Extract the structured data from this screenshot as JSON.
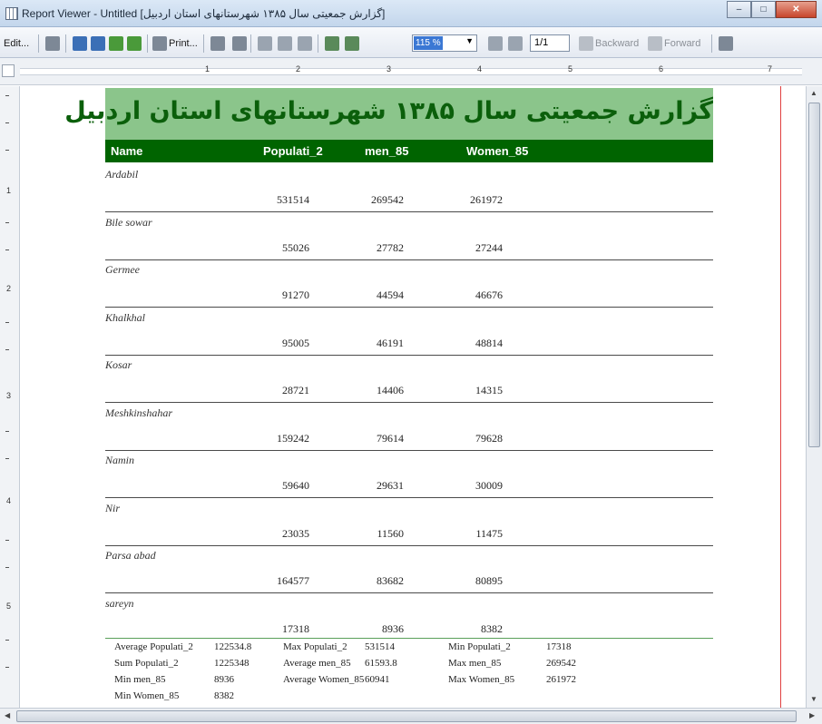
{
  "window": {
    "title": "Report Viewer - Untitled [گزارش جمعیتی سال ۱۳۸۵ شهرستانهای استان اردبیل]",
    "minimize_icon": "minimize-icon",
    "maximize_icon": "maximize-icon",
    "close_icon": "close-icon"
  },
  "toolbar": {
    "edit_label": "Edit...",
    "print_label": "Print...",
    "zoom_value": "115 %",
    "page_value": "1/1",
    "backward_label": "Backward",
    "forward_label": "Forward",
    "colors": {
      "icon_blue": "#3b6fb6",
      "icon_green": "#4a9a3a",
      "icon_gray": "#7d8896"
    }
  },
  "ruler": {
    "h_numbers": [
      "1",
      "2",
      "3",
      "4",
      "5",
      "6",
      "7"
    ],
    "v_numbers": [
      "1",
      "2",
      "3",
      "4",
      "5"
    ]
  },
  "report": {
    "title": "گزارش جمعیتی سال ۱۳۸۵ شهرستانهای استان اردبیل",
    "columns": [
      "Name",
      "Populati_2",
      "men_85",
      "Women_85"
    ],
    "rows": [
      {
        "name": "Ardabil",
        "population": "531514",
        "men": "269542",
        "women": "261972"
      },
      {
        "name": "Bile sowar",
        "population": "55026",
        "men": "27782",
        "women": "27244"
      },
      {
        "name": "Germee",
        "population": "91270",
        "men": "44594",
        "women": "46676"
      },
      {
        "name": "Khalkhal",
        "population": "95005",
        "men": "46191",
        "women": "48814"
      },
      {
        "name": "Kosar",
        "population": "28721",
        "men": "14406",
        "women": "14315"
      },
      {
        "name": "Meshkinshahar",
        "population": "159242",
        "men": "79614",
        "women": "79628"
      },
      {
        "name": "Namin",
        "population": "59640",
        "men": "29631",
        "women": "30009"
      },
      {
        "name": "Nir",
        "population": "23035",
        "men": "11560",
        "women": "11475"
      },
      {
        "name": "Parsa abad",
        "population": "164577",
        "men": "83682",
        "women": "80895"
      },
      {
        "name": "sareyn",
        "population": "17318",
        "men": "8936",
        "women": "8382"
      }
    ],
    "summary": [
      [
        "Average Populati_2",
        "122534.8",
        "Max Populati_2",
        "531514",
        "Min Populati_2",
        "17318"
      ],
      [
        "Sum Populati_2",
        "1225348",
        "Average men_85",
        "61593.8",
        "Max men_85",
        "269542"
      ],
      [
        "Min men_85",
        "8936",
        "Average Women_85",
        "60941",
        "Max Women_85",
        "261972"
      ],
      [
        "Min Women_85",
        "8382",
        "",
        "",
        "",
        ""
      ]
    ],
    "colors": {
      "title_bg": "#8bc58b",
      "title_text": "#0b5f0b",
      "header_bg": "#006400",
      "margin": "#e04040"
    }
  }
}
